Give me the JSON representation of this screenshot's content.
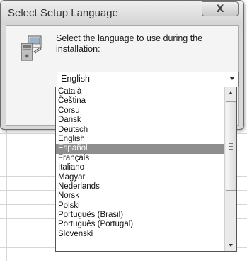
{
  "dialog": {
    "title": "Select Setup Language",
    "close_label": "X",
    "prompt": "Select the language to use during the installation:",
    "selected_language": "English"
  },
  "languages": [
    "Català",
    "Čeština",
    "Corsu",
    "Dansk",
    "Deutsch",
    "English",
    "Español",
    "Français",
    "Italiano",
    "Magyar",
    "Nederlands",
    "Norsk",
    "Polski",
    "Português (Brasil)",
    "Português (Portugal)",
    "Slovenski"
  ],
  "highlighted_index": 6,
  "icons": {
    "setup": "setup-install-icon",
    "close": "close-icon",
    "dropdown": "chevron-down-icon",
    "scroll_up": "scroll-up-icon",
    "scroll_down": "scroll-down-icon"
  },
  "colors": {
    "highlight": "#8e8e8e",
    "dialog_bg": "#d8d8d8",
    "client_bg": "#f4f4f4"
  }
}
